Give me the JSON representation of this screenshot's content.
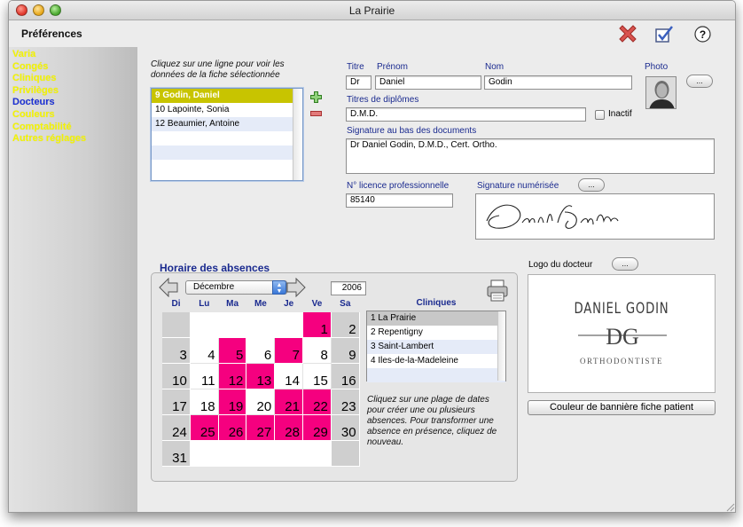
{
  "window": {
    "title": "La Prairie"
  },
  "sidebar": {
    "header": "Préférences",
    "items": [
      {
        "label": "Varia"
      },
      {
        "label": "Congés"
      },
      {
        "label": "Cliniques"
      },
      {
        "label": "Privilèges"
      },
      {
        "label": "Docteurs",
        "active": true
      },
      {
        "label": "Couleurs"
      },
      {
        "label": "Comptabilité"
      },
      {
        "label": "Autres réglages"
      }
    ]
  },
  "toolbar": {
    "close_icon": "red-x-icon",
    "validate_icon": "checkmark-icon",
    "help_label": "?"
  },
  "doctor_list": {
    "instruction": "Cliquez sur une ligne pour voir les données de la fiche sélectionnée",
    "rows": [
      {
        "label": "9  Godin, Daniel",
        "selected": true
      },
      {
        "label": "10  Lapointe, Sonia"
      },
      {
        "label": "12  Beaumier, Antoine"
      }
    ]
  },
  "form": {
    "titre_label": "Titre",
    "titre_value": "Dr",
    "prenom_label": "Prénom",
    "prenom_value": "Daniel",
    "nom_label": "Nom",
    "nom_value": "Godin",
    "photo_label": "Photo",
    "photo_button": "...",
    "diplomes_label": "Titres de diplômes",
    "diplomes_value": "D.M.D.",
    "inactif_label": "Inactif",
    "signature_label": "Signature au bas des documents",
    "signature_value": "Dr Daniel Godin, D.M.D., Cert.  Ortho.",
    "licence_label": "N° licence professionnelle",
    "licence_value": "85140",
    "sig_num_label": "Signature numérisée",
    "sig_num_button": "..."
  },
  "calendar": {
    "title": "Horaire des absences",
    "month": "Décembre",
    "year": "2006",
    "days_of_week": [
      "Di",
      "Lu",
      "Ma",
      "Me",
      "Je",
      "Ve",
      "Sa"
    ],
    "first_weekday": 5,
    "num_days": 31,
    "absent_days": [
      1,
      5,
      7,
      12,
      13,
      19,
      21,
      22,
      25,
      26,
      27,
      28,
      29
    ],
    "cliniques_label": "Cliniques",
    "cliniques": [
      {
        "label": "1  La Prairie",
        "selected": true
      },
      {
        "label": "2  Repentigny"
      },
      {
        "label": "3  Saint-Lambert"
      },
      {
        "label": "4  Iles-de-la-Madeleine"
      }
    ],
    "instruction": "Cliquez sur une plage de dates pour créer une ou plusieurs absences. Pour transformer une absence en présence, cliquez de nouveau."
  },
  "logo": {
    "label": "Logo du docteur",
    "button": "...",
    "name": "DANIEL GODIN",
    "monogram": "DG",
    "subtitle": "ORTHODONTISTE"
  },
  "banner_button": "Couleur de bannière fiche patient"
}
